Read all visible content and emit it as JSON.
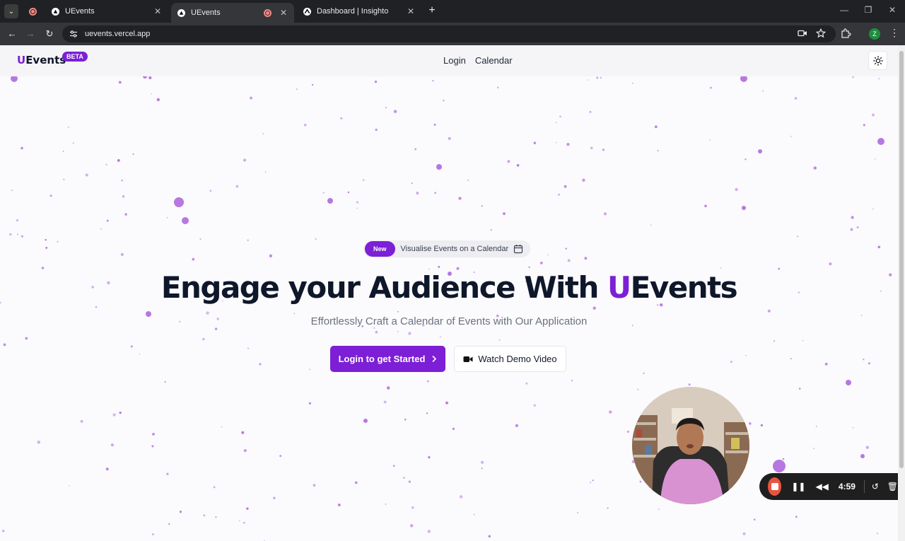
{
  "browser": {
    "tabs": [
      {
        "title": "UEvents",
        "active": false,
        "recording": false
      },
      {
        "title": "UEvents",
        "active": true,
        "recording": true
      },
      {
        "title": "Dashboard | Insighto",
        "active": false,
        "recording": false
      }
    ],
    "url": "uevents.vercel.app",
    "profile_initial": "Z",
    "new_tab_glyph": "+",
    "close_glyph": "✕"
  },
  "site": {
    "logo_first": "U",
    "logo_rest": "Events",
    "beta_label": "BETA",
    "nav": {
      "login": "Login",
      "calendar": "Calendar"
    }
  },
  "hero": {
    "badge_new": "New",
    "badge_text": "Visualise Events on a Calendar",
    "headline_prefix": "Engage your Audience With ",
    "headline_u": "U",
    "headline_suffix": "Events",
    "subheadline": "Effortlessly Craft a Calendar of Events with Our Application",
    "cta_primary": "Login to get Started",
    "cta_secondary": "Watch Demo Video"
  },
  "recorder": {
    "timer": "4:59"
  },
  "colors": {
    "accent": "#7c1fd6",
    "particle": "#b678e0",
    "record": "#e8553e"
  },
  "icons": [
    "calendar-icon",
    "chevron-right-icon",
    "video-icon",
    "sun-icon",
    "stop-icon",
    "pause-icon",
    "rewind-icon",
    "restart-icon",
    "trash-icon"
  ]
}
